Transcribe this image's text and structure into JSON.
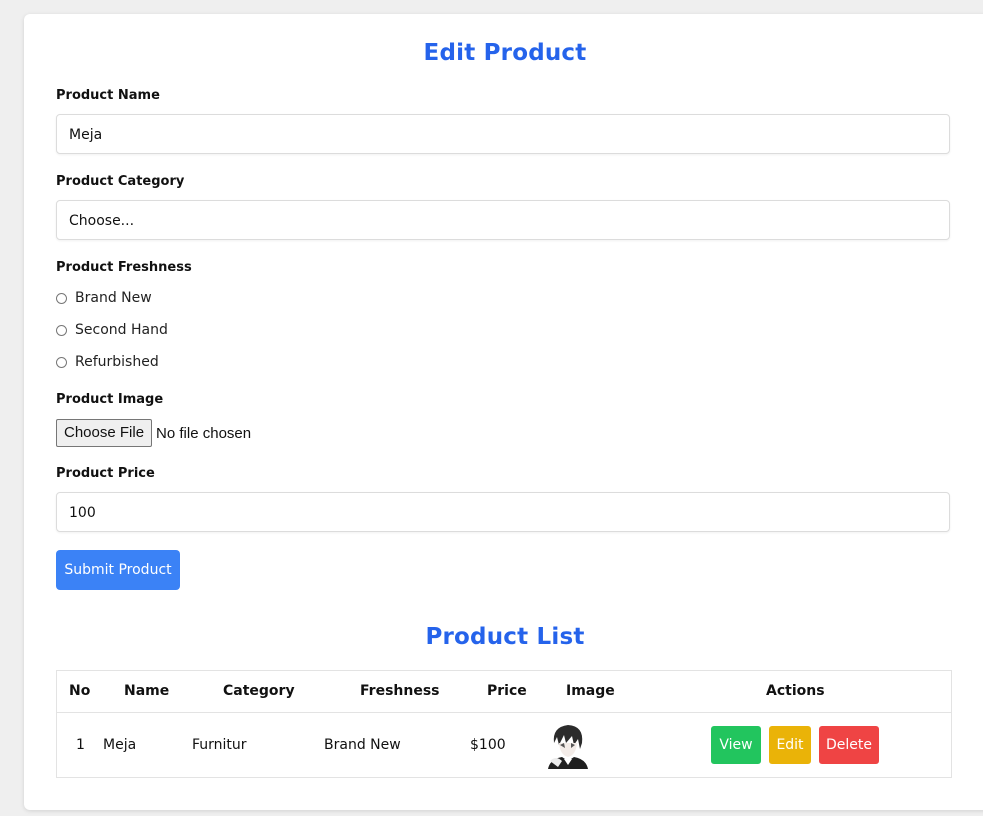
{
  "form": {
    "title": "Edit Product",
    "name_label": "Product Name",
    "name_value": "Meja",
    "category_label": "Product Category",
    "category_value": "Choose...",
    "freshness_label": "Product Freshness",
    "freshness_options": [
      "Brand New",
      "Second Hand",
      "Refurbished"
    ],
    "image_label": "Product Image",
    "file_button": "Choose File",
    "file_status": "No file chosen",
    "price_label": "Product Price",
    "price_value": "100",
    "submit_label": "Submit Product"
  },
  "list": {
    "title": "Product List",
    "headers": [
      "No",
      "Name",
      "Category",
      "Freshness",
      "Price",
      "Image",
      "Actions"
    ],
    "rows": [
      {
        "no": "1",
        "name": "Meja",
        "category": "Furnitur",
        "freshness": "Brand New",
        "price": "$100",
        "image": "anime-avatar-thumbnail",
        "actions": [
          "View",
          "Edit",
          "Delete"
        ]
      }
    ]
  },
  "colors": {
    "accent": "#2563eb",
    "submit": "#3b82f6",
    "view": "#22c55e",
    "edit": "#eab308",
    "delete": "#ef4444"
  }
}
